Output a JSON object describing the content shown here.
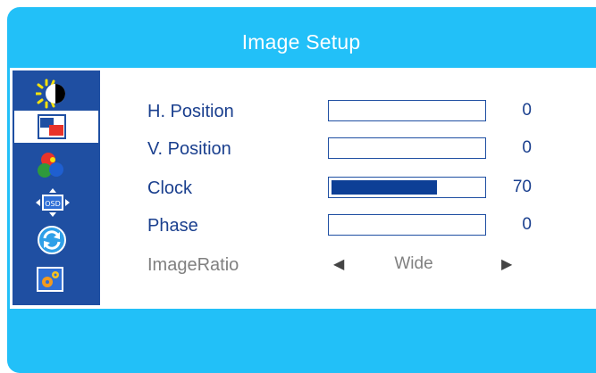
{
  "header": {
    "title": "Image Setup"
  },
  "sidebar": {
    "items": [
      {
        "icon": "brightness-contrast-icon",
        "active": false
      },
      {
        "icon": "image-setup-icon",
        "active": true
      },
      {
        "icon": "color-setup-icon",
        "active": false
      },
      {
        "icon": "osd-setup-icon",
        "active": false
      },
      {
        "icon": "reset-icon",
        "active": false
      },
      {
        "icon": "misc-settings-icon",
        "active": false
      }
    ]
  },
  "settings": {
    "h_position": {
      "label": "H. Position",
      "value": "0",
      "level": 0
    },
    "v_position": {
      "label": "V. Position",
      "value": "0",
      "level": 0
    },
    "clock": {
      "label": "Clock",
      "value": "70",
      "level": 0.7
    },
    "phase": {
      "label": "Phase",
      "value": "0",
      "level": 0
    },
    "image_ratio": {
      "label": "ImageRatio",
      "value": "Wide",
      "left_arrow": "◀",
      "right_arrow": "▶"
    }
  },
  "colors": {
    "frame": "#22c0f8",
    "sidebar": "#1f4fa2",
    "label": "#1a3f8e",
    "bar_fill": "#0d3f96",
    "disabled": "#808080"
  }
}
